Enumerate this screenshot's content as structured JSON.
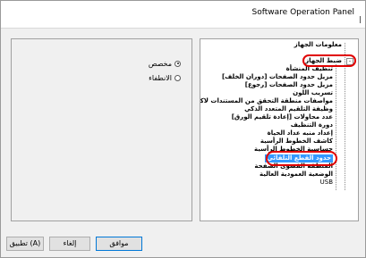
{
  "window": {
    "title": "Software Operation Panel",
    "close_glyph": "|"
  },
  "left_panel": {
    "options": [
      {
        "label": "مخصص",
        "checked": true
      },
      {
        "label": "الانطفاء",
        "checked": false
      }
    ]
  },
  "tree": {
    "items": [
      {
        "label": "معلومات الجهاز",
        "level": 1
      },
      {
        "label": "ضبط الجهاز",
        "level": 1,
        "expanded": true,
        "expand_glyph": "-"
      },
      {
        "label": "تنظيف المنشأة",
        "level": 2
      },
      {
        "label": "مزيل حدود الصفحات [دوران الخلف]",
        "level": 2
      },
      {
        "label": "مزيل حدود الصفحات [رجوع]",
        "level": 2
      },
      {
        "label": "تسريب اللون",
        "level": 2
      },
      {
        "label": "مواصفات منطقة التحقق من المستندات لاكتشاف التلقيم المتعدد",
        "level": 2
      },
      {
        "label": "وظيفة التلقيم المتعدد الذكي",
        "level": 2
      },
      {
        "label": "عدد محاولات [إعادة تلقيم الورق]",
        "level": 2
      },
      {
        "label": "دورة التنظيف",
        "level": 2
      },
      {
        "label": "إعداد منبه عداد الحياة",
        "level": 2
      },
      {
        "label": "كاشف الخطوط الرأسية",
        "level": 2
      },
      {
        "label": "حساسية الخطوط الرأسية",
        "level": 2
      },
      {
        "label": "حدود القطع التلقائي",
        "level": 2,
        "selected": true
      },
      {
        "label": "المنطقة القصوى الصفحة",
        "level": 2
      },
      {
        "label": "الوضعية العمودية العالية",
        "level": 2
      },
      {
        "label": "USB",
        "level": 2
      }
    ]
  },
  "buttons": {
    "ok": "موافق",
    "cancel": "إلغاء",
    "apply": "تطبيق (A)"
  },
  "colors": {
    "selection": "#3399ff",
    "annotation_red": "#e00000",
    "default_button_border": "#0078d7"
  }
}
